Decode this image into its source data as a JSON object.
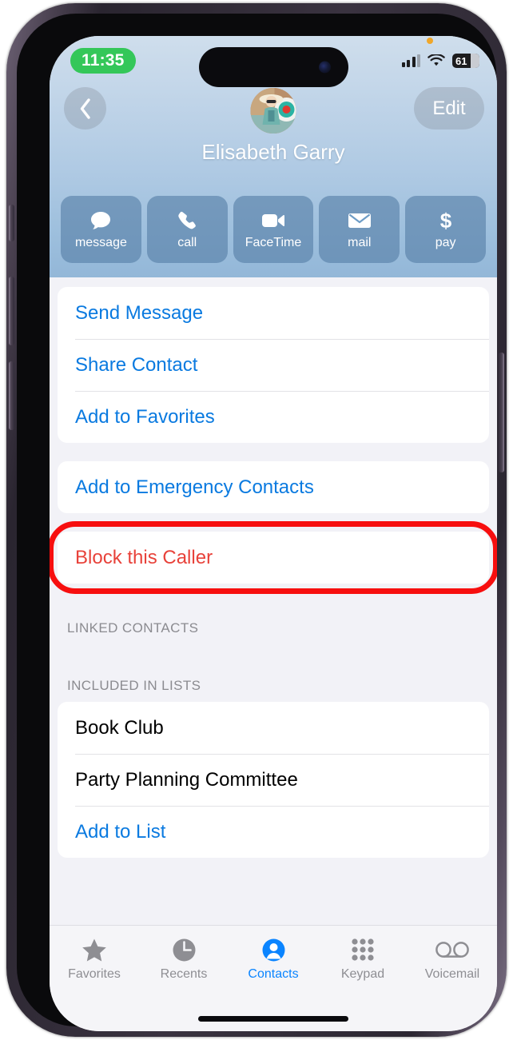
{
  "status_bar": {
    "time": "11:35",
    "battery_percent": "61",
    "icons": [
      "cellular-signal-icon",
      "wifi-icon",
      "battery-icon",
      "privacy-indicator-dot"
    ]
  },
  "header": {
    "back_label": "Back",
    "edit_label": "Edit",
    "contact_name": "Elisabeth Garry",
    "avatar_name": "contact-avatar"
  },
  "actions": [
    {
      "label": "message",
      "icon": "message-bubble-icon"
    },
    {
      "label": "call",
      "icon": "phone-handset-icon"
    },
    {
      "label": "FaceTime",
      "icon": "video-camera-icon"
    },
    {
      "label": "mail",
      "icon": "envelope-icon"
    },
    {
      "label": "pay",
      "icon": "dollar-sign-icon"
    }
  ],
  "groups": {
    "primary": [
      {
        "label": "Send Message",
        "style": "link"
      },
      {
        "label": "Share Contact",
        "style": "link"
      },
      {
        "label": "Add to Favorites",
        "style": "link"
      }
    ],
    "emergency": [
      {
        "label": "Add to Emergency Contacts",
        "style": "link"
      }
    ],
    "block": [
      {
        "label": "Block this Caller",
        "style": "danger"
      }
    ],
    "lists": [
      {
        "label": "Book Club",
        "style": "plain"
      },
      {
        "label": "Party Planning Committee",
        "style": "plain"
      },
      {
        "label": "Add to List",
        "style": "link"
      }
    ]
  },
  "section_headers": {
    "linked_contacts": "LINKED CONTACTS",
    "included_in_lists": "INCLUDED IN LISTS"
  },
  "tabs": [
    {
      "label": "Favorites",
      "icon": "star-icon",
      "active": false
    },
    {
      "label": "Recents",
      "icon": "clock-icon",
      "active": false
    },
    {
      "label": "Contacts",
      "icon": "person-circle-icon",
      "active": true
    },
    {
      "label": "Keypad",
      "icon": "keypad-grid-icon",
      "active": false
    },
    {
      "label": "Voicemail",
      "icon": "voicemail-icon",
      "active": false
    }
  ],
  "annotation": {
    "target": "Block this Caller",
    "shape": "rounded-rectangle-outline",
    "color": "#f70f0f"
  },
  "colors": {
    "accent_blue": "#0a7ae0",
    "tab_active_blue": "#0a84ff",
    "danger_red": "#e8423a",
    "annotation_red": "#f70f0f",
    "time_pill_green": "#34c759",
    "list_background": "#f2f2f7"
  }
}
